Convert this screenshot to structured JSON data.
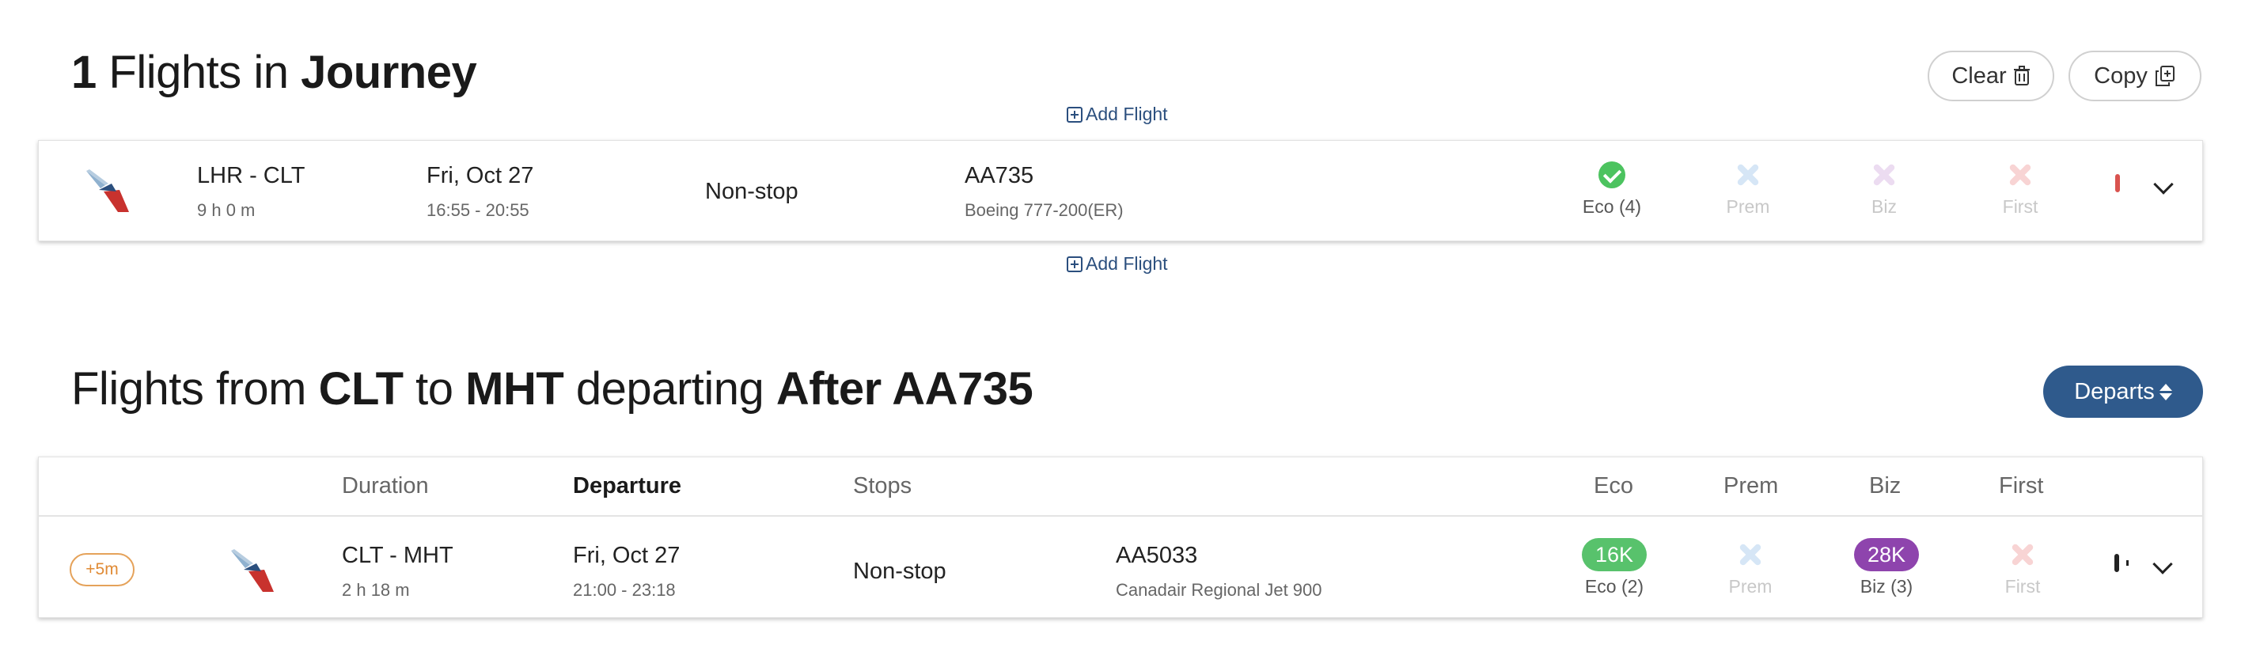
{
  "journey": {
    "count": "1",
    "title_mid": "Flights in",
    "title_bold": "Journey",
    "clear_label": "Clear",
    "copy_label": "Copy",
    "add_flight_label": "Add Flight",
    "flight": {
      "route": "LHR - CLT",
      "duration": "9 h 0 m",
      "date": "Fri, Oct 27",
      "times": "16:55 - 20:55",
      "stops": "Non-stop",
      "flight_no": "AA735",
      "aircraft": "Boeing 777-200(ER)",
      "cabins": [
        {
          "label": "Eco (4)",
          "available": true
        },
        {
          "label": "Prem",
          "available": false
        },
        {
          "label": "Biz",
          "available": false
        },
        {
          "label": "First",
          "available": false
        }
      ]
    }
  },
  "results": {
    "title_pre": "Flights from",
    "origin": "CLT",
    "title_to": "to",
    "destination": "MHT",
    "title_departing": "departing",
    "after": "After AA735",
    "sort_label": "Departs",
    "headers": {
      "duration": "Duration",
      "departure": "Departure",
      "stops": "Stops",
      "eco": "Eco",
      "prem": "Prem",
      "biz": "Biz",
      "first": "First"
    },
    "rows": [
      {
        "badge": "+5m",
        "route": "CLT - MHT",
        "duration": "2 h 18 m",
        "date": "Fri, Oct 27",
        "times": "21:00 - 23:18",
        "stops": "Non-stop",
        "flight_no": "AA5033",
        "aircraft": "Canadair Regional Jet 900",
        "eco_price": "16K",
        "eco_label": "Eco (2)",
        "prem_label": "Prem",
        "biz_price": "28K",
        "biz_label": "Biz (3)",
        "first_label": "First"
      }
    ]
  },
  "colors": {
    "accent": "#2f5a8c",
    "available": "#58c26c",
    "biz": "#8e44ad",
    "remove": "#d9534f",
    "badge": "#e08a34"
  },
  "icons": [
    "trash-icon",
    "copy-icon",
    "plus-square-icon",
    "american-airlines-logo",
    "check-circle-icon",
    "x-icon",
    "minus-square-icon",
    "chevron-down-icon",
    "sort-icon"
  ]
}
